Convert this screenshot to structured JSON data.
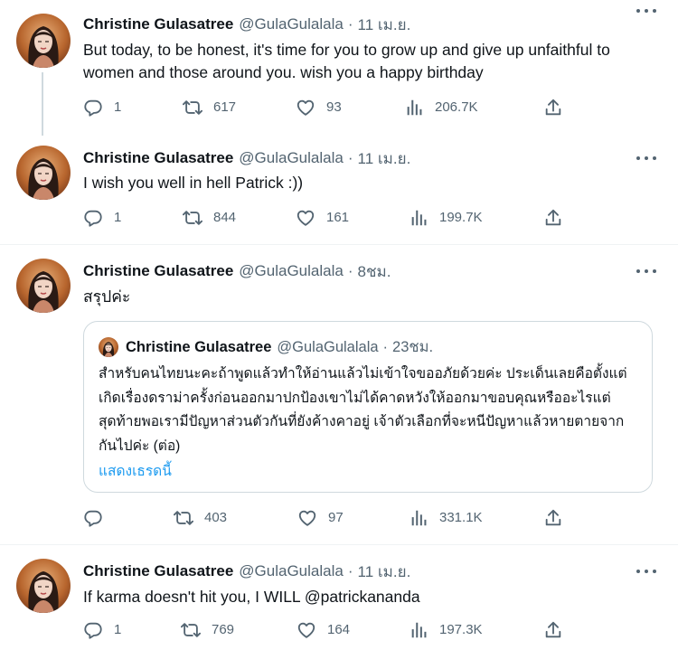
{
  "tweets": [
    {
      "name": "Christine Gulasatree",
      "handle": "@GulaGulalala",
      "time": "11 เม.ย.",
      "text": "But today, to be honest, it's time for you to grow up and give up unfaithful to women and those around you. wish you a happy birthday",
      "replies": "1",
      "retweets": "617",
      "likes": "93",
      "views": "206.7K"
    },
    {
      "name": "Christine Gulasatree",
      "handle": "@GulaGulalala",
      "time": "11 เม.ย.",
      "text": "I wish you well in hell Patrick :))",
      "replies": "1",
      "retweets": "844",
      "likes": "161",
      "views": "199.7K"
    },
    {
      "name": "Christine Gulasatree",
      "handle": "@GulaGulalala",
      "time": "8ชม.",
      "text": "สรุปค่ะ",
      "quote": {
        "name": "Christine Gulasatree",
        "handle": "@GulaGulalala",
        "time": "23ชม.",
        "text": "สำหรับคนไทยนะคะถ้าพูดแล้วทำให้อ่านแล้วไม่เข้าใจขออภัยด้วยค่ะ ประเด็นเลยคือตั้งแต่เกิดเรื่องดราม่าครั้งก่อนออกมาปกป้องเขาไม่ได้คาดหวังให้ออกมาขอบคุณหรืออะไรแต่สุดท้ายพอเรามีปัญหาส่วนตัวกันที่ยังค้างคาอยู่ เจ้าตัวเลือกที่จะหนีปัญหาแล้วหายตายจากกันไปค่ะ (ต่อ)",
        "show_thread": "แสดงเธรดนี้"
      },
      "replies": "",
      "retweets": "403",
      "likes": "97",
      "views": "331.1K"
    },
    {
      "name": "Christine Gulasatree",
      "handle": "@GulaGulalala",
      "time": "11 เม.ย.",
      "text": "If karma doesn't hit you, I WILL @patrickananda",
      "replies": "1",
      "retweets": "769",
      "likes": "164",
      "views": "197.3K"
    }
  ],
  "icons": {
    "reply": "reply-icon",
    "retweet": "retweet-icon",
    "like": "heart-icon",
    "views": "views-icon",
    "share": "share-icon",
    "more": "more-icon"
  },
  "colors": {
    "text": "#0f1419",
    "muted": "#536471",
    "link": "#1d9bf0",
    "border": "#cfd9de"
  }
}
